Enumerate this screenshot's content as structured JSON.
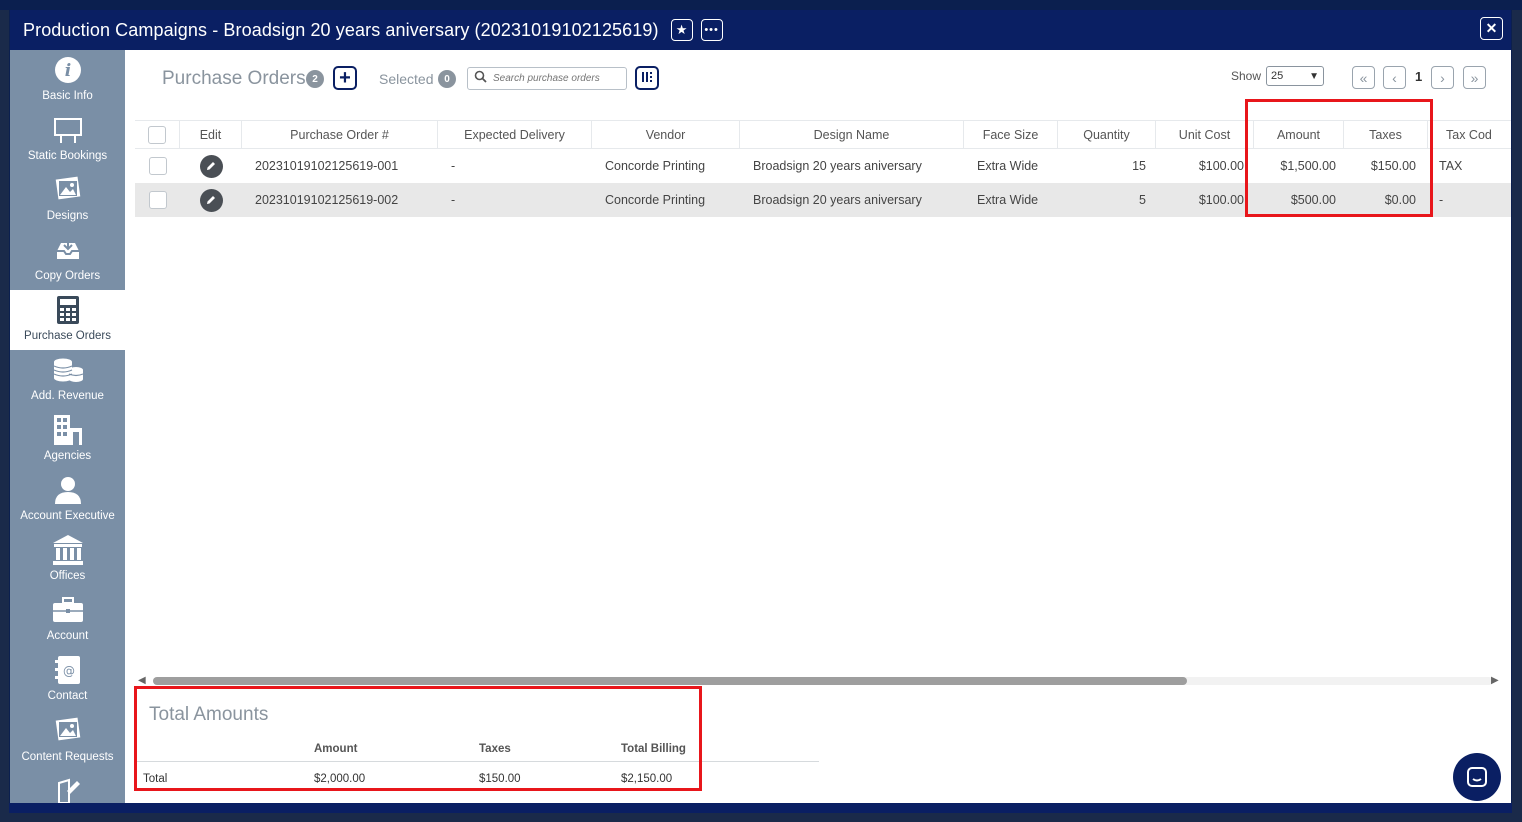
{
  "window": {
    "title": "Production Campaigns - Broadsign 20 years aniversary (20231019102125619)",
    "star_icon": "star-icon",
    "more_icon": "more-icon",
    "close_icon": "close-icon"
  },
  "sidebar": {
    "items": [
      {
        "label": "Basic Info",
        "icon": "info-icon"
      },
      {
        "label": "Static Bookings",
        "icon": "billboard-icon"
      },
      {
        "label": "Designs",
        "icon": "image-icon"
      },
      {
        "label": "Copy Orders",
        "icon": "inbox-icon"
      },
      {
        "label": "Purchase Orders",
        "icon": "calculator-icon"
      },
      {
        "label": "Add. Revenue",
        "icon": "coins-icon"
      },
      {
        "label": "Agencies",
        "icon": "building-icon"
      },
      {
        "label": "Account Executive",
        "icon": "person-icon"
      },
      {
        "label": "Offices",
        "icon": "bank-icon"
      },
      {
        "label": "Account",
        "icon": "briefcase-icon"
      },
      {
        "label": "Contact",
        "icon": "address-book-icon"
      },
      {
        "label": "Content Requests",
        "icon": "image-icon"
      }
    ],
    "active_index": 4
  },
  "toolbar": {
    "title": "Purchase Orders",
    "count": "2",
    "selected_label": "Selected",
    "selected_count": "0",
    "search_placeholder": "Search purchase orders",
    "show_label": "Show",
    "page_size": "25",
    "current_page": "1"
  },
  "grid": {
    "columns": [
      "Edit",
      "Purchase Order #",
      "Expected Delivery",
      "Vendor",
      "Design Name",
      "Face Size",
      "Quantity",
      "Unit Cost",
      "Amount",
      "Taxes",
      "Tax Cod"
    ],
    "rows": [
      {
        "po": "20231019102125619-001",
        "delivery": "-",
        "vendor": "Concorde Printing",
        "design": "Broadsign 20 years aniversary",
        "face": "Extra Wide",
        "qty": "15",
        "unit": "$100.00",
        "amount": "$1,500.00",
        "taxes": "$150.00",
        "taxcode": "TAX"
      },
      {
        "po": "20231019102125619-002",
        "delivery": "-",
        "vendor": "Concorde Printing",
        "design": "Broadsign 20 years aniversary",
        "face": "Extra Wide",
        "qty": "5",
        "unit": "$100.00",
        "amount": "$500.00",
        "taxes": "$0.00",
        "taxcode": "-"
      }
    ]
  },
  "totals": {
    "title": "Total Amounts",
    "headers": [
      "Amount",
      "Taxes",
      "Total Billing"
    ],
    "row_label": "Total",
    "amount": "$2,000.00",
    "taxes": "$150.00",
    "total_billing": "$2,150.00"
  },
  "colors": {
    "header_navy": "#0a1f63",
    "sidebar": "#7a8fa6",
    "highlight": "#e8161b"
  }
}
